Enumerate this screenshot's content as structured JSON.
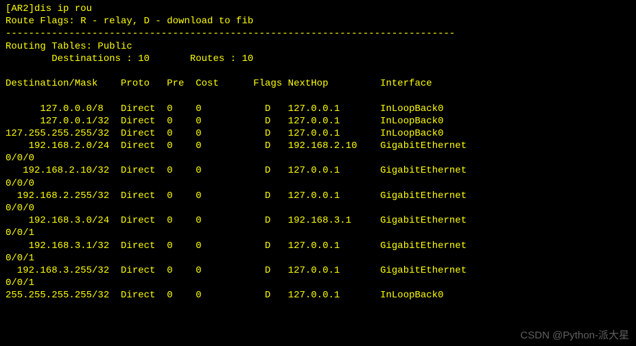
{
  "header": {
    "command_line": "[AR2]dis ip rou",
    "flags_line": "Route Flags: R - relay, D - download to fib"
  },
  "table_info": {
    "title": "Routing Tables: Public",
    "summary": "        Destinations : 10       Routes : 10"
  },
  "columns": "Destination/Mask    Proto   Pre  Cost      Flags NextHop         Interface",
  "rows": [
    "      127.0.0.0/8   Direct  0    0           D   127.0.0.1       InLoopBack0",
    "      127.0.0.1/32  Direct  0    0           D   127.0.0.1       InLoopBack0",
    "127.255.255.255/32  Direct  0    0           D   127.0.0.1       InLoopBack0",
    "    192.168.2.0/24  Direct  0    0           D   192.168.2.10    GigabitEthernet",
    "0/0/0",
    "   192.168.2.10/32  Direct  0    0           D   127.0.0.1       GigabitEthernet",
    "0/0/0",
    "  192.168.2.255/32  Direct  0    0           D   127.0.0.1       GigabitEthernet",
    "0/0/0",
    "    192.168.3.0/24  Direct  0    0           D   192.168.3.1     GigabitEthernet",
    "0/0/1",
    "    192.168.3.1/32  Direct  0    0           D   127.0.0.1       GigabitEthernet",
    "0/0/1",
    "  192.168.3.255/32  Direct  0    0           D   127.0.0.1       GigabitEthernet",
    "0/0/1",
    "255.255.255.255/32  Direct  0    0           D   127.0.0.1       InLoopBack0"
  ],
  "watermark": "CSDN @Python-派大星",
  "divider": "------------------------------------------------------------------------------"
}
